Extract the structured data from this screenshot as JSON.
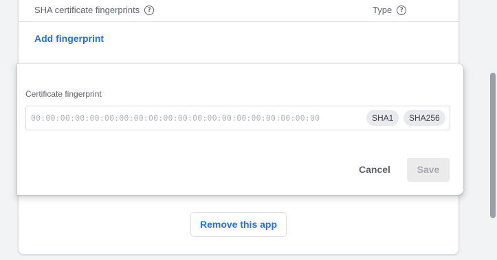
{
  "table": {
    "col_fingerprints": "SHA certificate fingerprints",
    "col_type": "Type",
    "help_glyph": "?"
  },
  "add_fingerprint_label": "Add fingerprint",
  "dialog": {
    "field_label": "Certificate fingerprint",
    "placeholder": "00:00:00:00:00:00:00:00:00:00:00:00:00:00:00:00:00:00:00:00",
    "chips": [
      "SHA1",
      "SHA256"
    ],
    "cancel_label": "Cancel",
    "save_label": "Save",
    "save_enabled": false
  },
  "remove_app_label": "Remove this app",
  "colors": {
    "accent": "#1a73e8",
    "text_secondary": "#5f6368",
    "disabled_bg": "#ebebeb"
  }
}
